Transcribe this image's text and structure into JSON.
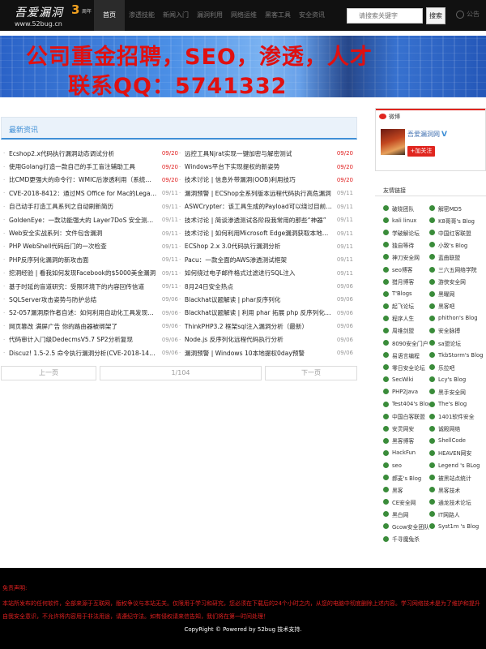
{
  "header": {
    "logo_title": "吾爱漏洞",
    "logo_years": "3",
    "logo_years_sub": "周年",
    "logo_url": "www.52bug.cn",
    "nav": [
      "首页",
      "渗透技能",
      "新闻入门",
      "漏洞利用",
      "网络运维",
      "黑客工具",
      "安全资讯"
    ],
    "search_placeholder": "请搜索关键字",
    "search_button": "搜索",
    "message_label": "公告"
  },
  "banner": {
    "line1": "公司重金招聘，SEO，渗透，人才",
    "line2": "联系QQ：5741332"
  },
  "latest": {
    "title": "最新资讯",
    "rows": [
      {
        "left": "Ecshop2.x代码执行漏洞动态调试分析",
        "left_date": "09/20",
        "left_hot": true,
        "right": "远控工具Njrat实现一键加密与解密测试",
        "right_date": "09/20",
        "right_hot": true
      },
      {
        "left": "使用Golang打造一款自己的手工盲注辅助工具",
        "left_date": "09/20",
        "left_hot": true,
        "right": "Windows平台下实现提权的新姿势",
        "right_date": "09/20",
        "right_hot": true
      },
      {
        "left": "比CMD更强大的命令行：WMIC后渗透利用（系统命令）",
        "left_date": "09/20",
        "left_hot": true,
        "right": "技术讨论 | 信息外带漏洞(OOB)利用技巧",
        "right_date": "09/20",
        "right_hot": true
      },
      {
        "left": "CVE-2018-8412：通过MS Office for Mac的Legacy Pa…",
        "left_date": "09/11",
        "left_hot": false,
        "right": "漏洞预警 | ECShop全系列版本远程代码执行高危漏洞",
        "right_date": "09/11",
        "right_hot": false
      },
      {
        "left": "自己动手打造工具系列之自动刷新简历",
        "left_date": "09/11",
        "left_hot": false,
        "right": "ASWCrypter：该工具生成的Payload可以绕过目前所有…",
        "right_date": "09/11",
        "right_hot": false
      },
      {
        "left": "GoldenEye：一款功能强大的 Layer7DoS 安全测试工具",
        "left_date": "09/11",
        "left_hot": false,
        "right": "技术讨论 | 简谈渗透测试各阶段我常用的那些“神器”",
        "right_date": "09/11",
        "right_hot": false
      },
      {
        "left": "Web安全实战系列：文件包含漏洞",
        "left_date": "09/11",
        "left_hot": false,
        "right": "技术讨论 | 如何利用Microsoft Edge漏洞获取本地文件?",
        "right_date": "09/11",
        "right_hot": false
      },
      {
        "left": "PHP WebShell代码后门的一次检查",
        "left_date": "09/11",
        "left_hot": false,
        "right": "ECShop 2.x 3.0代码执行漏洞分析",
        "right_date": "09/11",
        "right_hot": false
      },
      {
        "left": "PHP反序列化漏洞的新攻击面",
        "left_date": "09/11",
        "left_hot": false,
        "right": "Pacu：一款全面的AWS渗透测试框架",
        "right_date": "09/11",
        "right_hot": false
      },
      {
        "left": "挖洞经验 | 看我如何发现Facebook的$5000美金漏洞",
        "left_date": "09/11",
        "left_hot": false,
        "right": "如何绕过电子邮件格式过滤进行SQL注入",
        "right_date": "09/11",
        "right_hot": false
      },
      {
        "left": "基于时延的盲道研究：受限环境下的内容回传信道",
        "left_date": "09/11",
        "left_hot": false,
        "right": "8月24日安全热点",
        "right_date": "09/06",
        "right_hot": false
      },
      {
        "left": "SQLServer攻击姿势与防护总结",
        "left_date": "09/06",
        "left_hot": false,
        "right": "Blackhat议题解读 | phar反序列化",
        "right_date": "09/06",
        "right_hot": false
      },
      {
        "left": "S2-057漏洞原作者自述：如何利用自动化工具发现5个RCE",
        "left_date": "09/06",
        "left_hot": false,
        "right": "Blackhat议题解读 | 利用 phar 拓展 php 反序列化漏洞…",
        "right_date": "09/06",
        "right_hot": false
      },
      {
        "left": "网页篡改 满屏广告 你的路由器被绑架了",
        "left_date": "09/06",
        "left_hot": false,
        "right": "ThinkPHP3.2 框架sql注入漏洞分析（最新）",
        "right_date": "09/06",
        "right_hot": false
      },
      {
        "left": "代码审计入门级DedecmsV5.7 SP2分析复现",
        "left_date": "09/06",
        "left_hot": false,
        "right": "Node.js 反序列化远程代码执行分析",
        "right_date": "09/06",
        "right_hot": false
      },
      {
        "left": "Discuz! 1.5-2.5 命令执行漏洞分析(CVE-2018-14729)",
        "left_date": "09/06",
        "left_hot": false,
        "right": "漏洞预警 | Windows 10本地提权0day预警",
        "right_date": "09/06",
        "right_hot": false
      }
    ]
  },
  "pagination": {
    "prev": "上一页",
    "current": "1/104",
    "next": "下一页"
  },
  "weibo": {
    "title": "微博",
    "name": "吾爱漏洞网",
    "verified": "V",
    "follow": "+加关注"
  },
  "friends": {
    "title": "友情链接",
    "links": [
      "破晓团队",
      "解密MD5",
      "kali linux",
      "K8哥哥's Blog",
      "学破解论坛",
      "中国红客联盟",
      "独自等待",
      "小致's Blog",
      "神刀安全网",
      "蓝曲联盟",
      "seo博客",
      "三六五网络学院",
      "猎月博客",
      "游侠安全网",
      "T'Blogs",
      "黑曜网",
      "起飞论坛",
      "黑客吧",
      "程序人生",
      "phithon's Blog",
      "周维剑盟",
      "安全脉搏",
      "8090安全门户",
      "sa盟论坛",
      "易语言编程",
      "TkbStorm's Blog",
      "零日安全论坛",
      "乐拉吧",
      "SecWiki",
      "Lcy's Blog",
      "PHP2Java",
      "黑手安全网",
      "Test404's Blog",
      "The's Blog",
      "中国白客联盟",
      "1401软件安全",
      "安灵网安",
      "诚殿网络",
      "黑客博客",
      "ShellCode",
      "HackFun",
      "HEAVEN网安",
      "seo",
      "Legend 's BLog",
      "郝麦's Blog",
      "被黑站点统计",
      "黑客",
      "黑客技术",
      "CE安全网",
      "通龙技术论坛",
      "黑白网",
      "IT网路人",
      "Gcow安全团队",
      "Syst1m 's Blog",
      "千寻魔兔杀"
    ]
  },
  "footer": {
    "disclaimer_title": "免责声明:",
    "disclaimer": "本站所发布的任何软件，全部来源于互联网，版权争议与本站无关。仅限用于学习和研究，您必须在下载后的24个小时之内，从您的电脑中彻底删除上述内容。学习网络技术是为了维护和提升自我安全意识，不允许将内容用于非法用途，请遵纪守法。如有侵权请来信告知，我们将在第一时间处理！",
    "copyright": "CopyRight © Powered by 52bug 技术支持."
  }
}
